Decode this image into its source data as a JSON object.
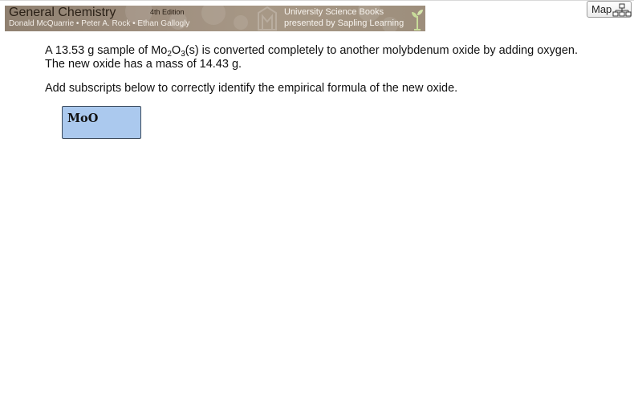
{
  "banner": {
    "title": "General Chemistry",
    "edition": "4th Edition",
    "authors": "Donald McQuarrie • Peter A. Rock • Ethan Gallogly",
    "publisher": "University Science Books",
    "presented": "presented by Sapling Learning",
    "logo_icon": "publisher-logo-icon",
    "sprout_icon": "sapling-sprout-icon"
  },
  "map_button": {
    "label": "Map",
    "icon": "sitemap-icon"
  },
  "question": {
    "line1_a": "A 13.53 g sample of Mo",
    "line1_sub1": "2",
    "line1_b": "O",
    "line1_sub2": "3",
    "line1_c": "(s) is converted completely to another molybdenum oxide by adding oxygen.",
    "line2": "The new oxide has a mass of 14.43 g.",
    "instruction": "Add subscripts below to correctly identify the empirical formula of the new oxide."
  },
  "formula_input": {
    "value": "MoO"
  },
  "colors": {
    "banner_brown": "#9d8e7c",
    "input_fill": "#abc9ee",
    "input_border": "#3b4a5c"
  }
}
